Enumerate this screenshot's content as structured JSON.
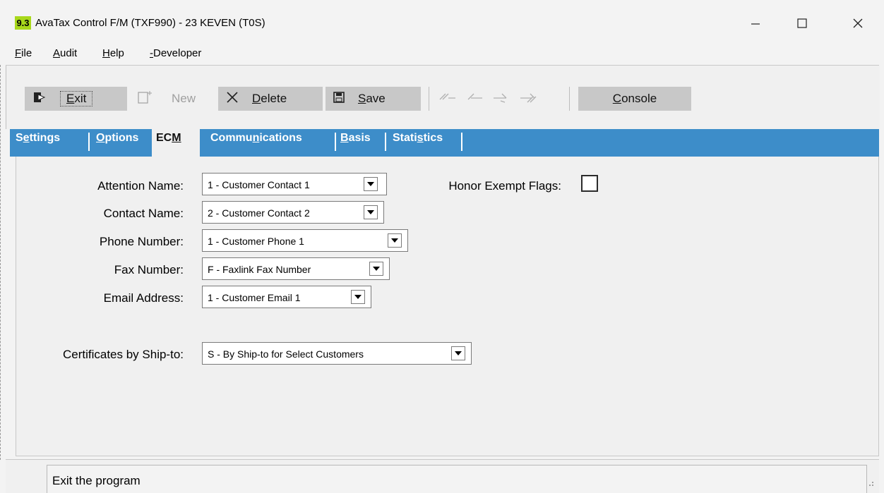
{
  "window": {
    "badge": "9.3",
    "title": "AvaTax Control F/M (TXF990) - 23 KEVEN (T0S)",
    "controls": [
      "minimize-icon",
      "maximize-icon",
      "close-icon"
    ]
  },
  "menu": {
    "file": {
      "u": "F",
      "rest": "ile"
    },
    "audit": {
      "u": "A",
      "rest": "udit"
    },
    "help": {
      "u": "H",
      "rest": "elp"
    },
    "developer": {
      "u": "-",
      "rest": "Developer"
    }
  },
  "toolbar": {
    "exit": {
      "u": "E",
      "rest": "xit"
    },
    "new": {
      "label": "New"
    },
    "delete": {
      "u": "D",
      "rest": "elete"
    },
    "save": {
      "u": "S",
      "rest": "ave"
    },
    "console": {
      "u": "C",
      "rest": "onsole"
    }
  },
  "tabs": {
    "settings": {
      "pre": "S",
      "u": "e",
      "post": "ttings"
    },
    "options": {
      "pre": "",
      "u": "O",
      "post": "ptions"
    },
    "ecm": {
      "pre": "EC",
      "u": "M",
      "post": ""
    },
    "communications": {
      "pre": "Commu",
      "u": "n",
      "post": "ications"
    },
    "basis": {
      "pre": "",
      "u": "B",
      "post": "asis"
    },
    "statistics": {
      "pre": "Stati",
      "u": "s",
      "post": "tics"
    }
  },
  "form": {
    "attention_label": "Attention Name:",
    "attention_value": "1 - Customer Contact 1",
    "contact_label": "Contact Name:",
    "contact_value": "2 - Customer Contact 2",
    "phone_label": "Phone Number:",
    "phone_value": "1 - Customer Phone 1",
    "fax_label": "Fax Number:",
    "fax_value": "F - Faxlink Fax Number",
    "email_label": "Email Address:",
    "email_value": "1 - Customer Email 1",
    "certs_label": "Certificates by Ship-to:",
    "certs_value": "S - By Ship-to for Select Customers",
    "honor_label": "Honor Exempt Flags:",
    "honor_checked": false
  },
  "status": {
    "text": "Exit the program"
  }
}
